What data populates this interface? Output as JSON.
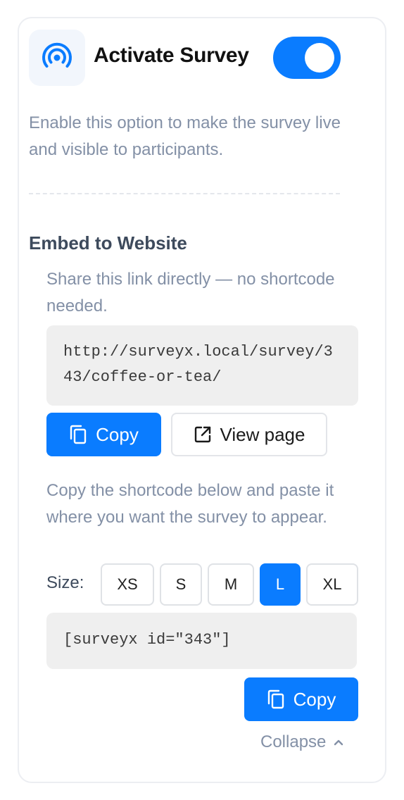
{
  "activation": {
    "title": "Activate Survey",
    "enabled": true,
    "description": "Enable this option to make the survey live and visible to participants."
  },
  "embed": {
    "title": "Embed to Website",
    "link_description": "Share this link directly — no shortcode needed.",
    "link_url": "http://surveyx.local/survey/343/coffee-or-tea/",
    "copy_label": "Copy",
    "view_page_label": "View page",
    "shortcode_description": "Copy the shortcode below and paste it where you want the survey to appear.",
    "size_label": "Size:",
    "sizes": [
      "XS",
      "S",
      "M",
      "L",
      "XL"
    ],
    "selected_size": "L",
    "shortcode": "[surveyx id=\"343\"]",
    "shortcode_copy_label": "Copy",
    "collapse_label": "Collapse"
  },
  "icons": {
    "header": "broadcast-icon",
    "copy": "copy-icon",
    "external": "external-link-icon",
    "collapse": "chevron-up-icon"
  },
  "colors": {
    "accent": "#0a7cff",
    "muted_text": "#8390a6",
    "code_bg": "#efefef"
  }
}
